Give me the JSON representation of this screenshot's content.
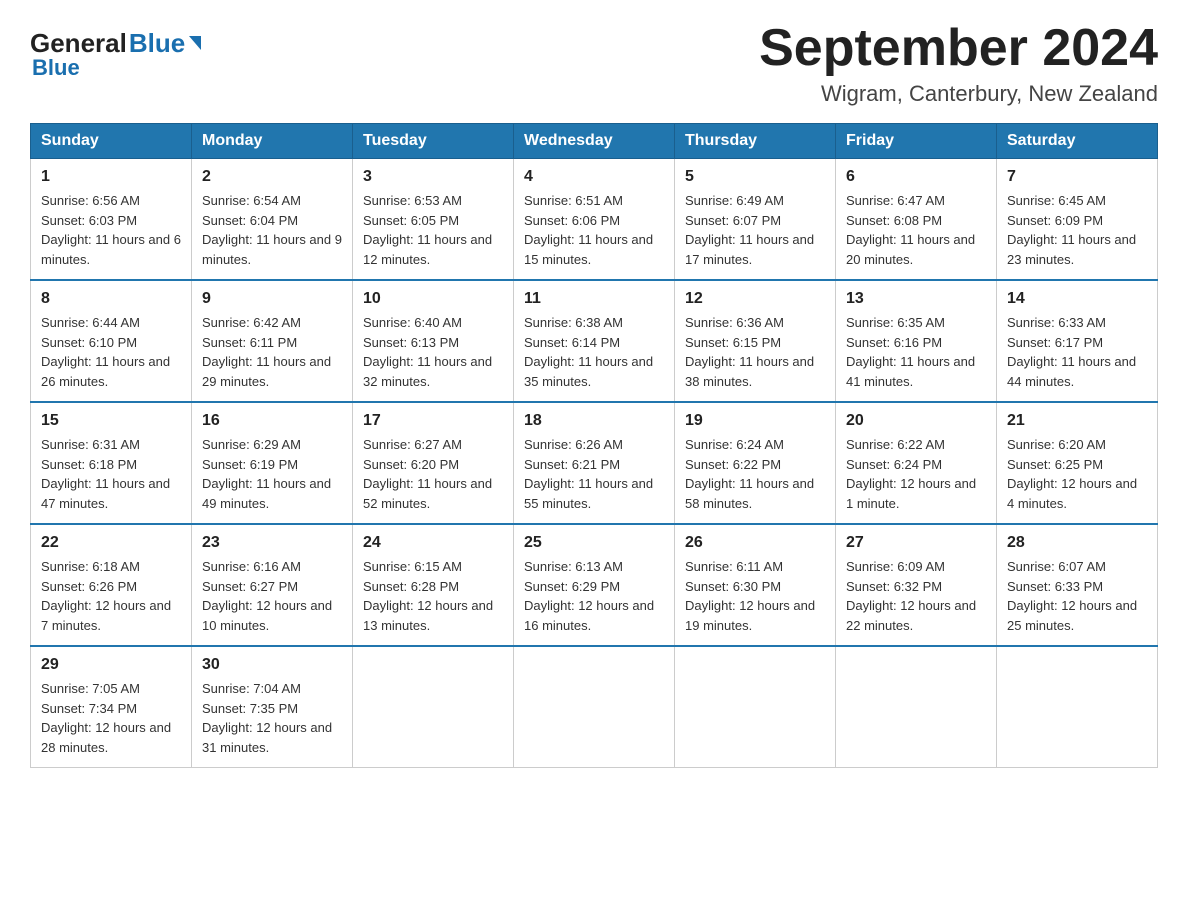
{
  "header": {
    "logo_general": "General",
    "logo_blue": "Blue",
    "main_title": "September 2024",
    "subtitle": "Wigram, Canterbury, New Zealand"
  },
  "weekdays": [
    "Sunday",
    "Monday",
    "Tuesday",
    "Wednesday",
    "Thursday",
    "Friday",
    "Saturday"
  ],
  "weeks": [
    [
      {
        "day": "1",
        "sunrise": "6:56 AM",
        "sunset": "6:03 PM",
        "daylight": "11 hours and 6 minutes."
      },
      {
        "day": "2",
        "sunrise": "6:54 AM",
        "sunset": "6:04 PM",
        "daylight": "11 hours and 9 minutes."
      },
      {
        "day": "3",
        "sunrise": "6:53 AM",
        "sunset": "6:05 PM",
        "daylight": "11 hours and 12 minutes."
      },
      {
        "day": "4",
        "sunrise": "6:51 AM",
        "sunset": "6:06 PM",
        "daylight": "11 hours and 15 minutes."
      },
      {
        "day": "5",
        "sunrise": "6:49 AM",
        "sunset": "6:07 PM",
        "daylight": "11 hours and 17 minutes."
      },
      {
        "day": "6",
        "sunrise": "6:47 AM",
        "sunset": "6:08 PM",
        "daylight": "11 hours and 20 minutes."
      },
      {
        "day": "7",
        "sunrise": "6:45 AM",
        "sunset": "6:09 PM",
        "daylight": "11 hours and 23 minutes."
      }
    ],
    [
      {
        "day": "8",
        "sunrise": "6:44 AM",
        "sunset": "6:10 PM",
        "daylight": "11 hours and 26 minutes."
      },
      {
        "day": "9",
        "sunrise": "6:42 AM",
        "sunset": "6:11 PM",
        "daylight": "11 hours and 29 minutes."
      },
      {
        "day": "10",
        "sunrise": "6:40 AM",
        "sunset": "6:13 PM",
        "daylight": "11 hours and 32 minutes."
      },
      {
        "day": "11",
        "sunrise": "6:38 AM",
        "sunset": "6:14 PM",
        "daylight": "11 hours and 35 minutes."
      },
      {
        "day": "12",
        "sunrise": "6:36 AM",
        "sunset": "6:15 PM",
        "daylight": "11 hours and 38 minutes."
      },
      {
        "day": "13",
        "sunrise": "6:35 AM",
        "sunset": "6:16 PM",
        "daylight": "11 hours and 41 minutes."
      },
      {
        "day": "14",
        "sunrise": "6:33 AM",
        "sunset": "6:17 PM",
        "daylight": "11 hours and 44 minutes."
      }
    ],
    [
      {
        "day": "15",
        "sunrise": "6:31 AM",
        "sunset": "6:18 PM",
        "daylight": "11 hours and 47 minutes."
      },
      {
        "day": "16",
        "sunrise": "6:29 AM",
        "sunset": "6:19 PM",
        "daylight": "11 hours and 49 minutes."
      },
      {
        "day": "17",
        "sunrise": "6:27 AM",
        "sunset": "6:20 PM",
        "daylight": "11 hours and 52 minutes."
      },
      {
        "day": "18",
        "sunrise": "6:26 AM",
        "sunset": "6:21 PM",
        "daylight": "11 hours and 55 minutes."
      },
      {
        "day": "19",
        "sunrise": "6:24 AM",
        "sunset": "6:22 PM",
        "daylight": "11 hours and 58 minutes."
      },
      {
        "day": "20",
        "sunrise": "6:22 AM",
        "sunset": "6:24 PM",
        "daylight": "12 hours and 1 minute."
      },
      {
        "day": "21",
        "sunrise": "6:20 AM",
        "sunset": "6:25 PM",
        "daylight": "12 hours and 4 minutes."
      }
    ],
    [
      {
        "day": "22",
        "sunrise": "6:18 AM",
        "sunset": "6:26 PM",
        "daylight": "12 hours and 7 minutes."
      },
      {
        "day": "23",
        "sunrise": "6:16 AM",
        "sunset": "6:27 PM",
        "daylight": "12 hours and 10 minutes."
      },
      {
        "day": "24",
        "sunrise": "6:15 AM",
        "sunset": "6:28 PM",
        "daylight": "12 hours and 13 minutes."
      },
      {
        "day": "25",
        "sunrise": "6:13 AM",
        "sunset": "6:29 PM",
        "daylight": "12 hours and 16 minutes."
      },
      {
        "day": "26",
        "sunrise": "6:11 AM",
        "sunset": "6:30 PM",
        "daylight": "12 hours and 19 minutes."
      },
      {
        "day": "27",
        "sunrise": "6:09 AM",
        "sunset": "6:32 PM",
        "daylight": "12 hours and 22 minutes."
      },
      {
        "day": "28",
        "sunrise": "6:07 AM",
        "sunset": "6:33 PM",
        "daylight": "12 hours and 25 minutes."
      }
    ],
    [
      {
        "day": "29",
        "sunrise": "7:05 AM",
        "sunset": "7:34 PM",
        "daylight": "12 hours and 28 minutes."
      },
      {
        "day": "30",
        "sunrise": "7:04 AM",
        "sunset": "7:35 PM",
        "daylight": "12 hours and 31 minutes."
      },
      null,
      null,
      null,
      null,
      null
    ]
  ],
  "labels": {
    "sunrise": "Sunrise:",
    "sunset": "Sunset:",
    "daylight": "Daylight:"
  }
}
